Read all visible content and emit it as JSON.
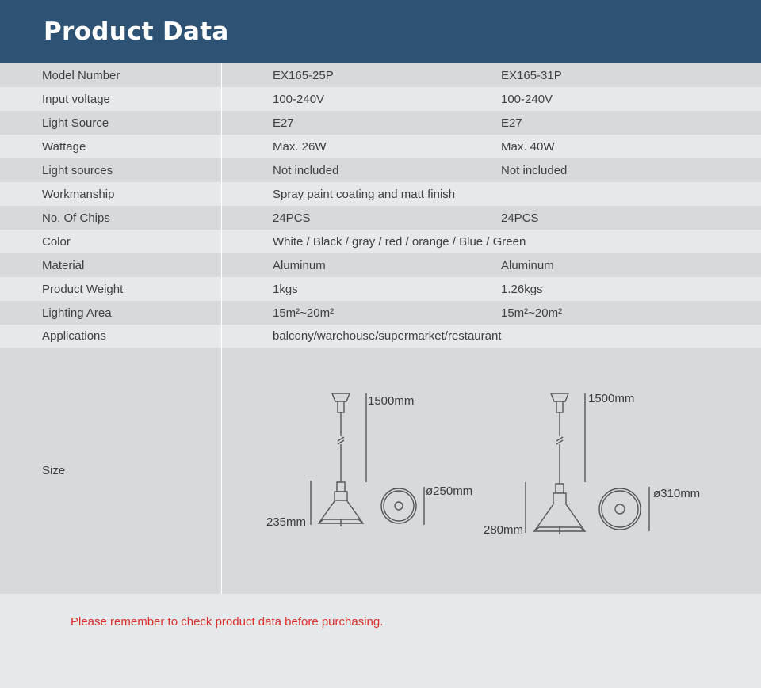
{
  "header": {
    "title": "Product Data"
  },
  "rows": [
    {
      "label": "Model Number",
      "a": "EX165-25P",
      "b": "EX165-31P"
    },
    {
      "label": "Input voltage",
      "a": "100-240V",
      "b": "100-240V"
    },
    {
      "label": "Light Source",
      "a": "E27",
      "b": "E27"
    },
    {
      "label": "Wattage",
      "a": "Max. 26W",
      "b": "Max. 40W"
    },
    {
      "label": "Light sources",
      "a": "Not included",
      "b": "Not included"
    },
    {
      "label": "Workmanship",
      "span": "Spray paint coating and matt finish"
    },
    {
      "label": "No. Of Chips",
      "a": "24PCS",
      "b": "24PCS"
    },
    {
      "label": "Color",
      "span": "White / Black / gray / red / orange / Blue / Green"
    },
    {
      "label": "Material",
      "a": "Aluminum",
      "b": "Aluminum"
    },
    {
      "label": "Product Weight",
      "a": "1kgs",
      "b": "1.26kgs"
    },
    {
      "label": "Lighting Area",
      "a": "15m²~20m²",
      "b": "15m²~20m²"
    },
    {
      "label": "Applications",
      "span": "balcony/warehouse/supermarket/restaurant"
    }
  ],
  "size": {
    "label": "Size",
    "lamp_a": {
      "cable": "1500mm",
      "height": "235mm",
      "diameter": "ø250mm"
    },
    "lamp_b": {
      "cable": "1500mm",
      "height": "280mm",
      "diameter": "ø310mm"
    }
  },
  "footer": {
    "note": "Please remember to check product data before purchasing."
  }
}
